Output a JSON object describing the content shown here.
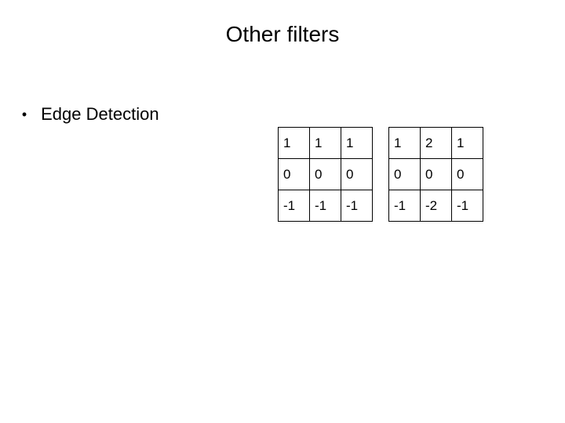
{
  "title": "Other filters",
  "bullet": "Edge Detection",
  "matrix_left": {
    "rows": [
      [
        "1",
        "1",
        "1"
      ],
      [
        "0",
        "0",
        "0"
      ],
      [
        "-1",
        "-1",
        "-1"
      ]
    ]
  },
  "matrix_right": {
    "rows": [
      [
        "1",
        "2",
        "1"
      ],
      [
        "0",
        "0",
        "0"
      ],
      [
        "-1",
        "-2",
        "-1"
      ]
    ]
  }
}
